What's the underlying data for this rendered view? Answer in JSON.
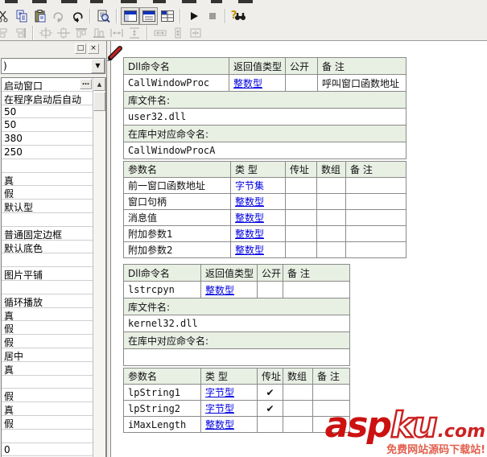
{
  "toolbar": {
    "row1_icons": [
      "cut",
      "copy",
      "paste",
      "redo",
      "undo",
      "find-in-document",
      "view-form",
      "view-code",
      "view-table",
      "run",
      "stop",
      "help-find"
    ],
    "row2_icons": [
      "align-left-edges",
      "align-right-edges",
      "center-horizontal",
      "center-vertical",
      "align-tops",
      "align-bottoms",
      "space-across",
      "space-down",
      "same-width",
      "same-height",
      "same-size"
    ],
    "help_qmark": "?"
  },
  "sidebar": {
    "restore_button": "□",
    "close_button": "×",
    "combo_value": ")",
    "combo_arrow": "▼",
    "ellipsis_button": "…",
    "scroll_up": "▲",
    "rows": [
      "启动窗口",
      "在程序启动后自动",
      "50",
      "50",
      "380",
      "250",
      "",
      "真",
      "假",
      "默认型",
      "",
      "普通固定边框",
      "默认底色",
      "",
      "图片平铺",
      "",
      "循环播放",
      "真",
      "假",
      "假",
      "居中",
      "真",
      "",
      "假",
      "真",
      "假",
      "",
      "0"
    ]
  },
  "commands": [
    {
      "header": {
        "name": "Dll命令名",
        "ret": "返回值类型",
        "public": "公开",
        "remark": "备 注"
      },
      "name": "CallWindowProc",
      "ret_type": "整数型",
      "public": "",
      "remark": "呼叫窗口函数地址",
      "lib_label": "库文件名:",
      "lib_name": "user32.dll",
      "alias_label": "在库中对应命令名:",
      "alias": "CallWindowProcA",
      "param_header": {
        "name": "参数名",
        "type": "类 型",
        "byref": "传址",
        "array": "数组",
        "remark": "备 注"
      },
      "params": [
        {
          "name": "前一窗口函数地址",
          "type": "字节集",
          "byref": "",
          "array": "",
          "remark": ""
        },
        {
          "name": "窗口句柄",
          "type": "整数型",
          "byref": "",
          "array": "",
          "remark": ""
        },
        {
          "name": "消息值",
          "type": "整数型",
          "byref": "",
          "array": "",
          "remark": ""
        },
        {
          "name": "附加参数1",
          "type": "整数型",
          "byref": "",
          "array": "",
          "remark": ""
        },
        {
          "name": "附加参数2",
          "type": "整数型",
          "byref": "",
          "array": "",
          "remark": ""
        }
      ]
    },
    {
      "header": {
        "name": "Dll命令名",
        "ret": "返回值类型",
        "public": "公开",
        "remark": "备 注"
      },
      "name": "lstrcpyn",
      "ret_type": "整数型",
      "public": "",
      "remark": "",
      "lib_label": "库文件名:",
      "lib_name": "kernel32.dll",
      "alias_label": "在库中对应命令名:",
      "alias": "",
      "param_header": {
        "name": "参数名",
        "type": "类 型",
        "byref": "传址",
        "array": "数组",
        "remark": "备 注"
      },
      "params": [
        {
          "name": "lpString1",
          "type": "字节型",
          "byref": "✔",
          "array": "",
          "remark": ""
        },
        {
          "name": "lpString2",
          "type": "字节型",
          "byref": "✔",
          "array": "",
          "remark": ""
        },
        {
          "name": "iMaxLength",
          "type": "整数型",
          "byref": "",
          "array": "",
          "remark": ""
        }
      ]
    }
  ],
  "watermark": {
    "part1": "asp",
    "part2": "ku",
    "part3": ".com",
    "tagline": "免费网站源码下载站!"
  },
  "colors": {
    "header_bg": "#e8efe3",
    "table_border": "#8a8a8a",
    "type_link": "#0000e0",
    "command_name": "#00009a",
    "dll_name": "#8b0000",
    "remark_green": "#007700",
    "check_red": "#8b0000"
  }
}
